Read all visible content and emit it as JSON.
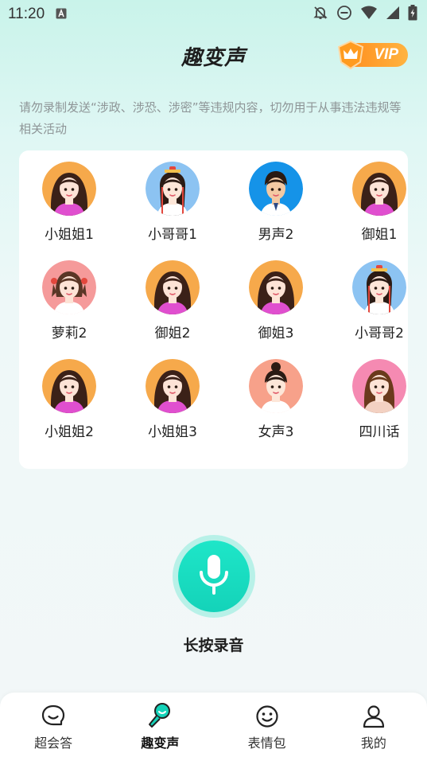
{
  "status_bar": {
    "time": "11:20"
  },
  "header": {
    "title": "趣变声",
    "vip_label": "VIP"
  },
  "notice": "请勿录制发送“涉政、涉恐、涉密”等违规内容，切勿用于从事违法违规等相关活动",
  "voices": [
    {
      "label": "小姐姐1",
      "bg": "#f6a94b",
      "hair": "#3b2118",
      "skin": "#fde3d6",
      "shirt": "#e04fcf",
      "style": "girl"
    },
    {
      "label": "小哥哥1",
      "bg": "#8cc3f2",
      "hair": "#2b1b14",
      "skin": "#fde6d8",
      "shirt": "#ffffff",
      "style": "ancient"
    },
    {
      "label": "男声2",
      "bg": "#1593e8",
      "hair": "#2a1a12",
      "skin": "#f3c9a3",
      "shirt": "#ffffff",
      "style": "man"
    },
    {
      "label": "御姐1",
      "bg": "#f6a94b",
      "hair": "#3b2118",
      "skin": "#fde3d6",
      "shirt": "#e04fcf",
      "style": "girl"
    },
    {
      "label": "萝莉2",
      "bg": "#f59a9a",
      "hair": "#5a3626",
      "skin": "#fde3d6",
      "shirt": "#ffffff",
      "style": "loli"
    },
    {
      "label": "御姐2",
      "bg": "#f6a94b",
      "hair": "#3b2118",
      "skin": "#fde3d6",
      "shirt": "#e04fcf",
      "style": "girl"
    },
    {
      "label": "御姐3",
      "bg": "#f6a94b",
      "hair": "#3b2118",
      "skin": "#fde3d6",
      "shirt": "#e04fcf",
      "style": "girl"
    },
    {
      "label": "小哥哥2",
      "bg": "#8cc3f2",
      "hair": "#2b1b14",
      "skin": "#fde6d8",
      "shirt": "#ffffff",
      "style": "ancient"
    },
    {
      "label": "小姐姐2",
      "bg": "#f6a94b",
      "hair": "#3b2118",
      "skin": "#fde3d6",
      "shirt": "#e04fcf",
      "style": "girl"
    },
    {
      "label": "小姐姐3",
      "bg": "#f6a94b",
      "hair": "#3b2118",
      "skin": "#fde3d6",
      "shirt": "#e04fcf",
      "style": "girl"
    },
    {
      "label": "女声3",
      "bg": "#f7a18a",
      "hair": "#2b1b14",
      "skin": "#fde6d8",
      "shirt": "#ffffff",
      "style": "bun"
    },
    {
      "label": "四川话",
      "bg": "#f58ab2",
      "hair": "#6a3a1c",
      "skin": "#fde3d6",
      "shirt": "#f3d1c2",
      "style": "plain"
    }
  ],
  "record": {
    "label": "长按录音",
    "accent": "#14d3b9"
  },
  "tabs": [
    {
      "label": "超会答",
      "icon": "chat-bubble-icon",
      "active": false
    },
    {
      "label": "趣变声",
      "icon": "microphone-icon",
      "active": true
    },
    {
      "label": "表情包",
      "icon": "smiley-icon",
      "active": false
    },
    {
      "label": "我的",
      "icon": "user-icon",
      "active": false
    }
  ]
}
